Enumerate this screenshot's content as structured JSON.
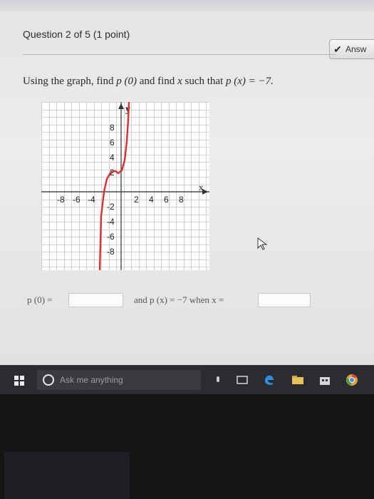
{
  "question": {
    "title": "Question 2 of 5 (1 point)",
    "answer_button_label": "Answ",
    "prompt_before": "Using the graph, find ",
    "prompt_p0": "p (0)",
    "prompt_mid": " and find ",
    "prompt_x": "x",
    "prompt_after": " such that ",
    "prompt_eq": "p (x)  =  −7."
  },
  "graph": {
    "y_label": "y",
    "x_label": "x",
    "y_ticks_pos": [
      "8",
      "6",
      "4",
      "2"
    ],
    "y_ticks_neg": [
      "-2",
      "-4",
      "-6",
      "-8"
    ],
    "x_ticks_neg": [
      "-8",
      "-6",
      "-4"
    ],
    "x_ticks_pos": [
      "2",
      "4",
      "6",
      "8"
    ],
    "curve_color": "#d9312e",
    "grid_color": "#c6c6c9"
  },
  "answer_row": {
    "p0_label": "p (0)  =",
    "and_label": "and p (x)  =  −7 when x  ="
  },
  "taskbar": {
    "search_placeholder": "Ask me anything"
  }
}
